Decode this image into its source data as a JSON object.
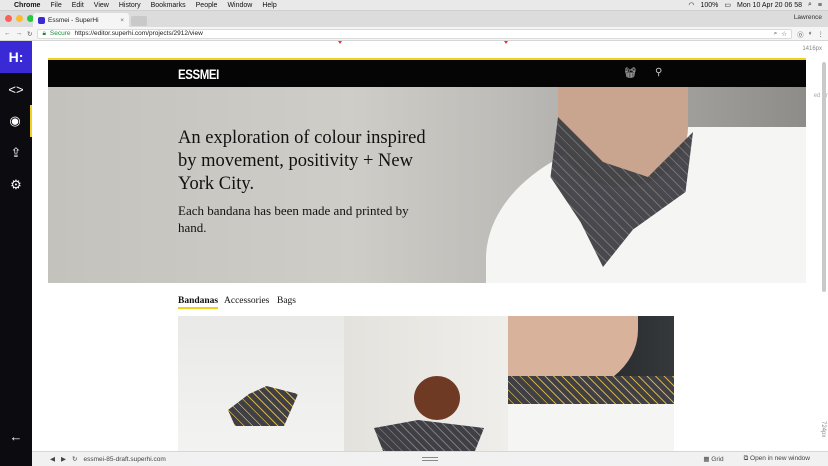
{
  "mac_menu": {
    "apple": "",
    "items": [
      "Chrome",
      "File",
      "Edit",
      "View",
      "History",
      "Bookmarks",
      "People",
      "Window",
      "Help"
    ],
    "battery": "100%",
    "datetime": "Mon 10 Apr 20 06 58"
  },
  "browser": {
    "tab_title": "Essmei - SuperHi",
    "user": "Lawrence",
    "secure_label": "Secure",
    "url": "https://editor.superhi.com/projects/2912/view"
  },
  "editor": {
    "width_readout": "1416px",
    "height_readout": "724px",
    "side_text": "ed Pr",
    "preview_domain": "essmei-85-draft.superhi.com",
    "grid_label": "Grid",
    "open_new_window_label": "Open in new window"
  },
  "site": {
    "logo": "ESSMEI",
    "hero_title": "An exploration of colour inspired by movement, positivity + New York City.",
    "hero_subtitle": "Each bandana has been made and printed by hand.",
    "nav": [
      "Bandanas",
      "Accessories",
      "Bags"
    ]
  },
  "colors": {
    "accent_yellow": "#f0d21c",
    "superhi_purple": "#3a2ad6",
    "sidebar_dark": "#0b0b10"
  }
}
